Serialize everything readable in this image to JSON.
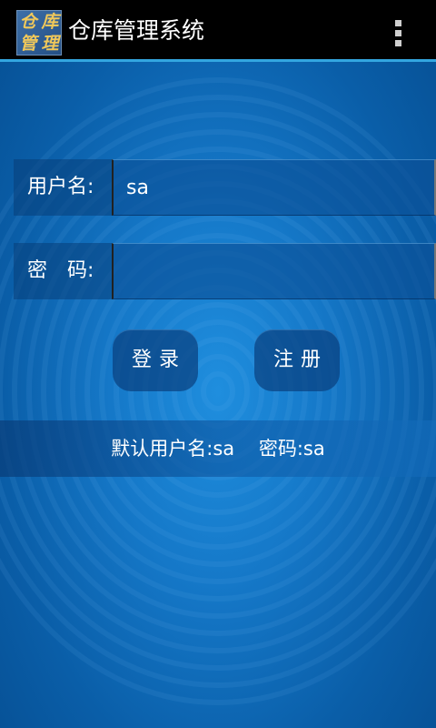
{
  "action_bar": {
    "icon_chars": [
      "仓",
      "库",
      "管",
      "理"
    ],
    "title": "仓库管理系统",
    "overflow_icon": "overflow-menu-icon"
  },
  "form": {
    "username_label": "用户名:",
    "username_value": "sa",
    "password_label": "密　码:",
    "password_value": ""
  },
  "buttons": {
    "login_label": "登录",
    "register_label": "注册"
  },
  "hint": {
    "text": "默认用户名:sa    密码:sa"
  },
  "colors": {
    "accent": "#33a6e0",
    "background": "#1578c8",
    "icon_text": "#f0c85a"
  }
}
